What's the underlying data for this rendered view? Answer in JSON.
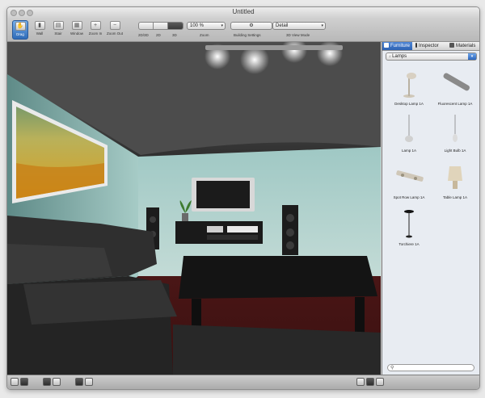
{
  "window": {
    "title": "Untitled"
  },
  "toolbar": {
    "tools": [
      {
        "label": "Drag",
        "icon": "hand-icon",
        "active": true
      },
      {
        "label": "Wall",
        "icon": "wall-icon",
        "active": false
      },
      {
        "label": "Stair",
        "icon": "stair-icon",
        "active": false
      },
      {
        "label": "Window",
        "icon": "window-icon",
        "active": false
      },
      {
        "label": "Zoom In",
        "icon": "zoom-in-icon",
        "active": false
      },
      {
        "label": "Zoom Out",
        "icon": "zoom-out-icon",
        "active": false
      }
    ],
    "view_modes": {
      "labels": [
        "2D/3D",
        "2D",
        "3D"
      ],
      "selected": "3D"
    },
    "zoom": {
      "value": "100 %",
      "label": "Zoom"
    },
    "building_settings": {
      "label": "Building Settings",
      "icon": "gear-icon"
    },
    "view_mode_3d": {
      "value": "Detail",
      "label": "3D View Mode"
    }
  },
  "sidebar": {
    "tabs": [
      {
        "label": "Furniture",
        "icon": "furniture-icon",
        "selected": true
      },
      {
        "label": "Inspector",
        "icon": "info-icon",
        "selected": false
      },
      {
        "label": "Materials",
        "icon": "materials-icon",
        "selected": false
      }
    ],
    "category": "Lamps",
    "items": [
      {
        "label": "Desktop Lamp 1A",
        "icon": "desktop-lamp-icon"
      },
      {
        "label": "Fluorescent Lamp 1A",
        "icon": "fluorescent-lamp-icon"
      },
      {
        "label": "Lamp 1A",
        "icon": "pendant-lamp-icon"
      },
      {
        "label": "Light Bulb 1A",
        "icon": "light-bulb-icon"
      },
      {
        "label": "Spot Row Lamp 1A",
        "icon": "spot-row-lamp-icon"
      },
      {
        "label": "Table Lamp 1A",
        "icon": "table-lamp-icon"
      },
      {
        "label": "Torchiere 1A",
        "icon": "torchiere-icon"
      }
    ],
    "search": {
      "placeholder": "",
      "icon": "search-icon"
    }
  },
  "colors": {
    "accent": "#2f6bb8",
    "selected_tab": "#3a72c4"
  }
}
